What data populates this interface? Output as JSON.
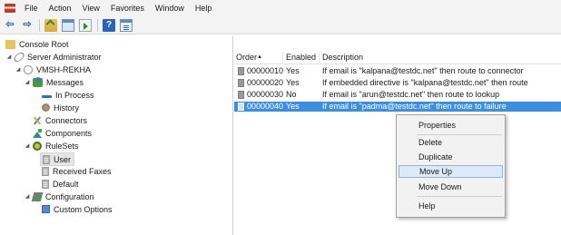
{
  "menubar": {
    "items": [
      "File",
      "Action",
      "View",
      "Favorites",
      "Window",
      "Help"
    ]
  },
  "toolbar": {
    "buttons": [
      "back-arrow-icon",
      "forward-arrow-icon",
      "folder-up-icon",
      "show-hide-console-tree-icon",
      "export-list-icon",
      "help-icon",
      "properties-icon"
    ]
  },
  "tree": {
    "console_root": "Console Root",
    "server_admin": "Server Administrator",
    "computer": "VMSH-REKHA",
    "messages": "Messages",
    "in_process": "In Process",
    "history": "History",
    "connectors": "Connectors",
    "components": "Components",
    "rulesets": "RuleSets",
    "user": "User",
    "received_faxes": "Received Faxes",
    "default": "Default",
    "configuration": "Configuration",
    "custom_options": "Custom Options"
  },
  "list": {
    "columns": {
      "order": "Order",
      "sort_indicator": "▲",
      "enabled": "Enabled",
      "description": "Description"
    },
    "rows": [
      {
        "order": "00000010",
        "enabled": "Yes",
        "description": "If email is \"kalpana@testdc.net\" then route to connector"
      },
      {
        "order": "00000020",
        "enabled": "Yes",
        "description": "If embedded directive is \"kalpana@testdc.net\" then route"
      },
      {
        "order": "00000030",
        "enabled": "No",
        "description": "If email is \"arun@testdc.net\" then route to lookup"
      },
      {
        "order": "00000040",
        "enabled": "Yes",
        "description": "If email is \"padma@testdc.net\" then route to failure"
      }
    ],
    "selected_row": 3
  },
  "context_menu": {
    "properties": "Properties",
    "delete": "Delete",
    "duplicate": "Duplicate",
    "move_up": "Move Up",
    "move_down": "Move Down",
    "help": "Help",
    "highlighted": "Move Up"
  },
  "colors": {
    "selection": "#3c8fe0",
    "menu_highlight": "#dde9f7"
  }
}
